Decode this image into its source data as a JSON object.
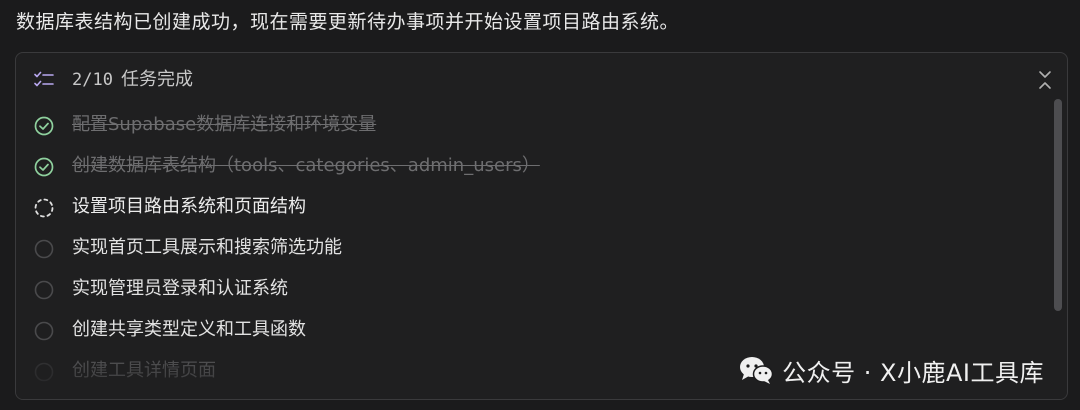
{
  "intro_text": "数据库表结构已创建成功，现在需要更新待办事项并开始设置项目路由系统。",
  "panel": {
    "progress": "2/10",
    "header_label": "任务完成"
  },
  "tasks": [
    {
      "label": "配置Supabase数据库连接和环境变量",
      "status": "completed"
    },
    {
      "label": "创建数据库表结构（tools、categories、admin_users）",
      "status": "completed"
    },
    {
      "label": "设置项目路由系统和页面结构",
      "status": "in_progress"
    },
    {
      "label": "实现首页工具展示和搜索筛选功能",
      "status": "pending"
    },
    {
      "label": "实现管理员登录和认证系统",
      "status": "pending"
    },
    {
      "label": "创建共享类型定义和工具函数",
      "status": "pending"
    },
    {
      "label": "创建工具详情页面",
      "status": "pending"
    }
  ],
  "watermark": {
    "text": "公众号 · X小鹿AI工具库"
  },
  "colors": {
    "background": "#1b1b1c",
    "panel_border": "#3a3a3c",
    "done_check": "#8fd19e",
    "done_text": "#6e6e70",
    "pending_circle": "#4a4a4c",
    "accent_icon": "#b9a8f0"
  },
  "icons": {
    "header": "task-list-icon",
    "collapse": "chevrons-collapse-icon",
    "completed": "check-circle-icon",
    "in_progress": "spinner-dashed-circle-icon",
    "pending": "empty-circle-icon",
    "watermark": "wechat-icon"
  }
}
